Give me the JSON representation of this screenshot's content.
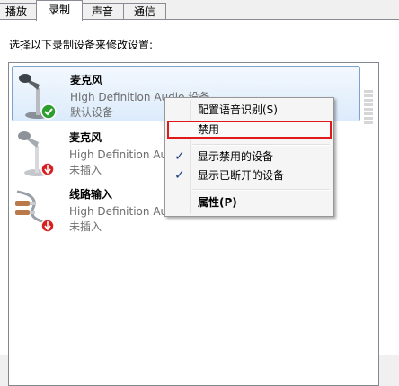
{
  "tabs": [
    {
      "label": "播放"
    },
    {
      "label": "录制"
    },
    {
      "label": "声音"
    },
    {
      "label": "通信"
    }
  ],
  "instruction": "选择以下录制设备来修改设置:",
  "devices": [
    {
      "name": "麦克风",
      "description": "High Definition Audio 设备",
      "status": "默认设备",
      "icon": "microphone-icon",
      "badge": "default-check-icon"
    },
    {
      "name": "麦克风",
      "description": "High Definition Audio 设备",
      "status": "未插入",
      "icon": "microphone-icon",
      "badge": "unplugged-arrow-icon"
    },
    {
      "name": "线路输入",
      "description": "High Definition Audio 设备",
      "status": "未插入",
      "icon": "line-in-cable-icon",
      "badge": "unplugged-arrow-icon"
    }
  ],
  "context_menu": {
    "configure_speech": "配置语音识别(S)",
    "disable": "禁用",
    "show_disabled": "显示禁用的设备",
    "show_disconnected": "显示已断开的设备",
    "properties": "属性(P)",
    "check_mark": "✓"
  },
  "colors": {
    "highlight_outline": "#e01a1a",
    "selection_border": "#7da2ce",
    "default_badge": "#2e9e2e",
    "unplugged_badge": "#d92020"
  }
}
